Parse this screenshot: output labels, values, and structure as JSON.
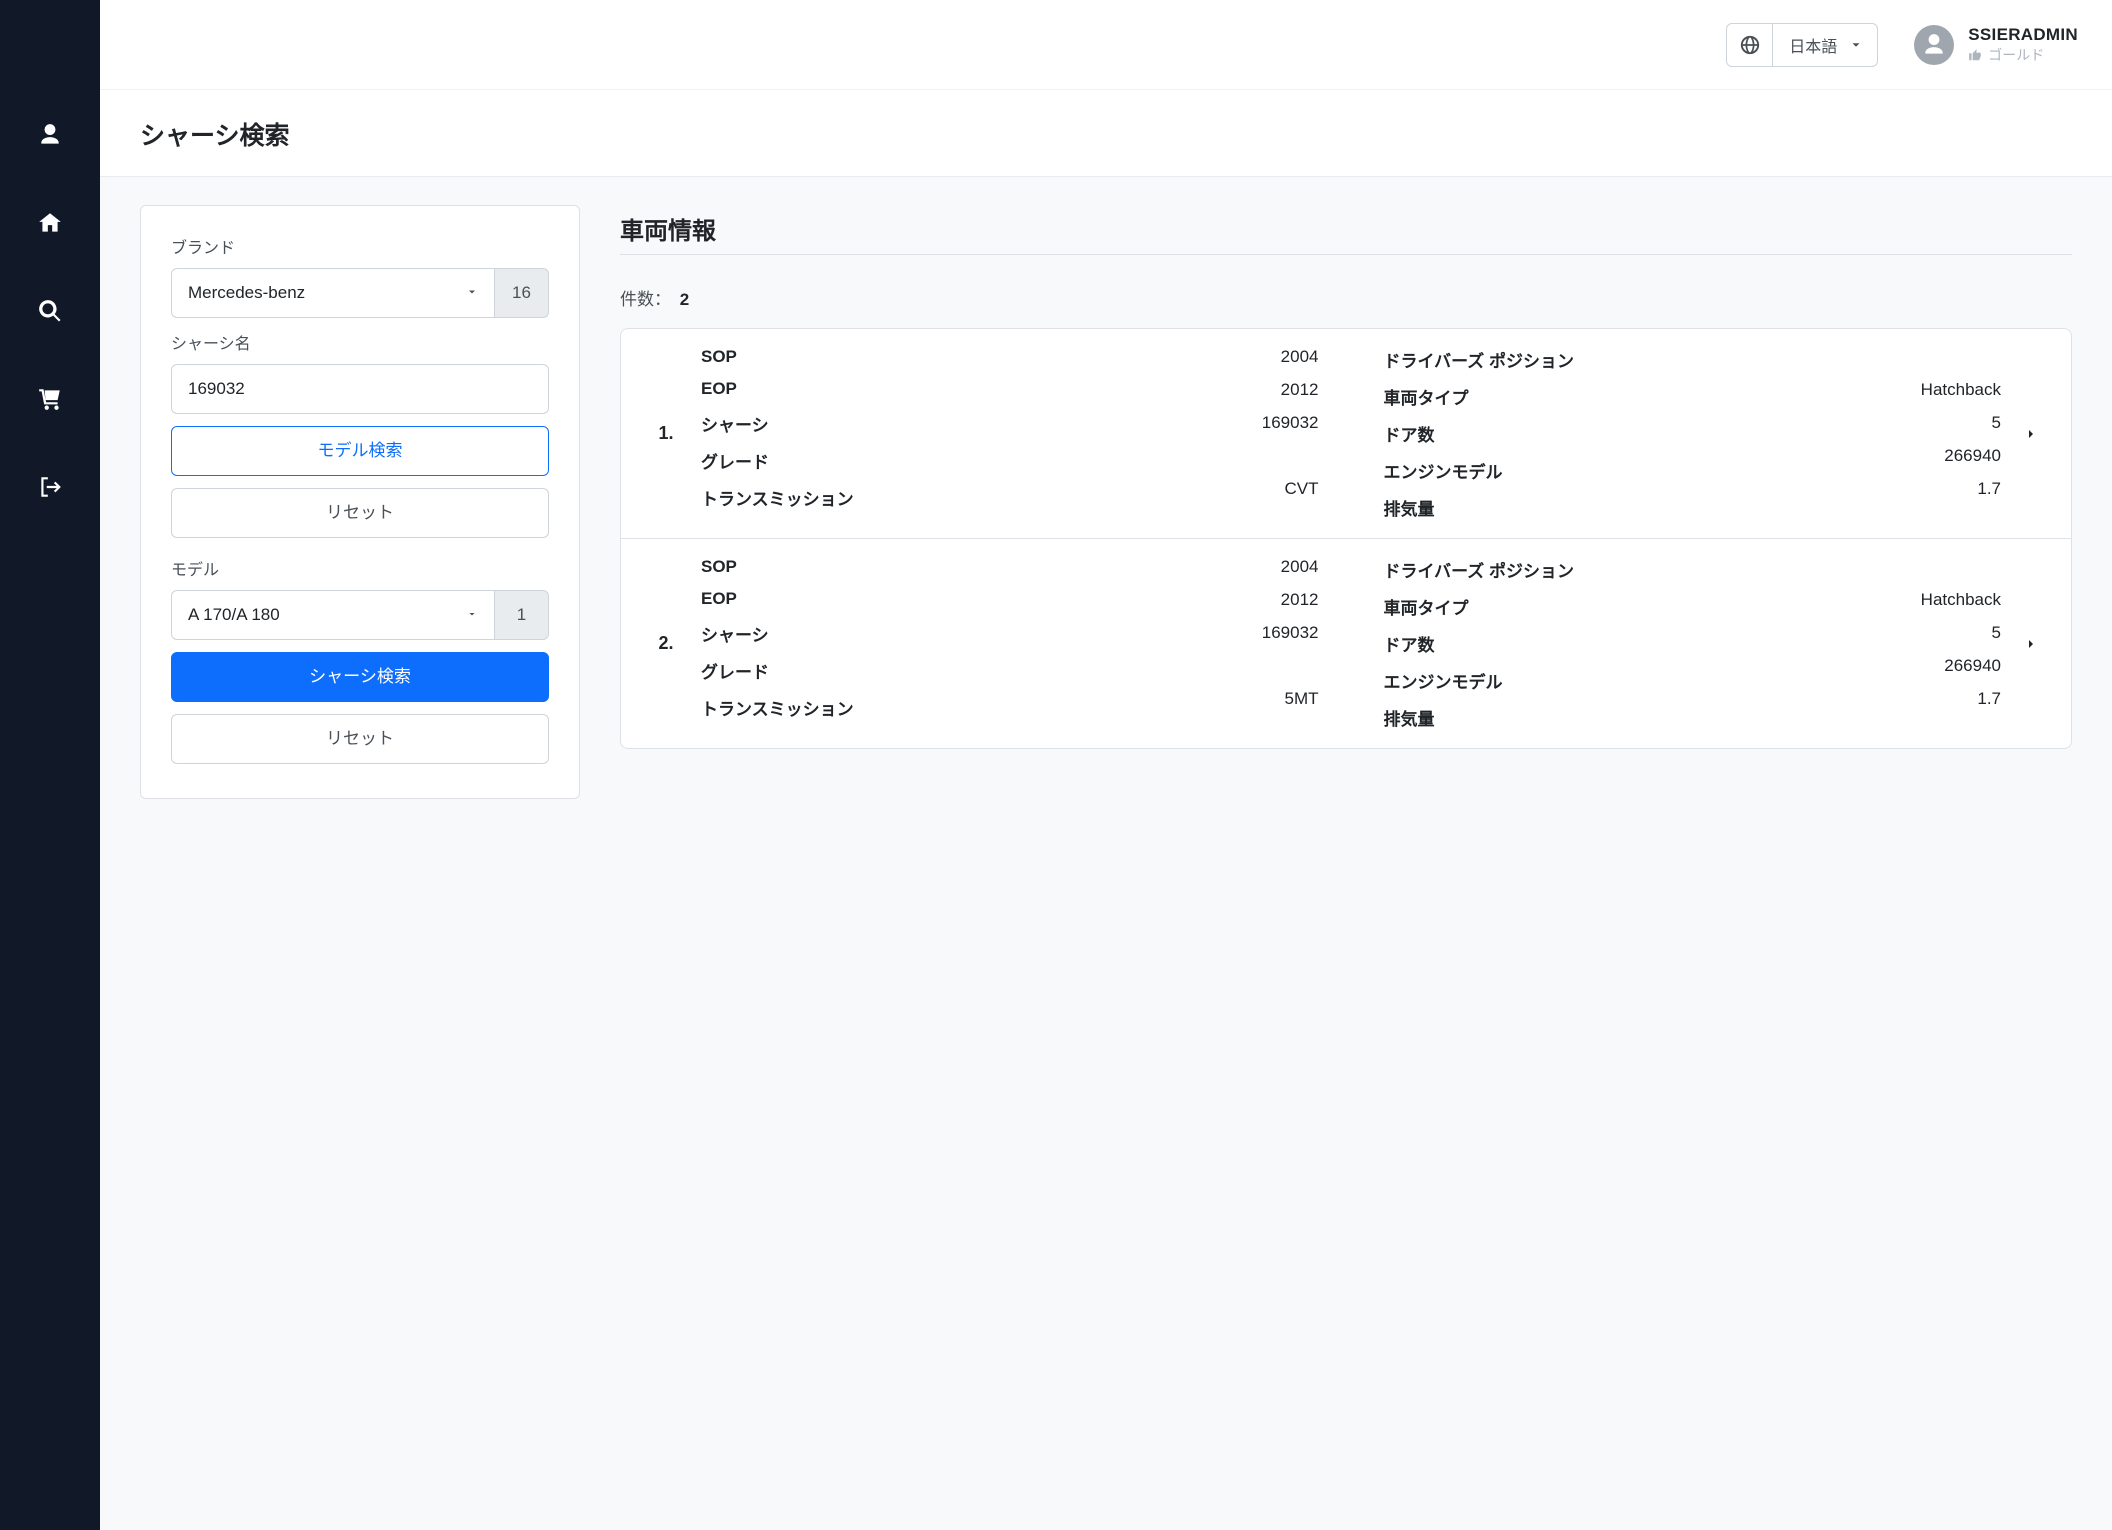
{
  "header": {
    "language_label": "日本語",
    "user_name": "SSIERADMIN",
    "user_rank": "ゴールド"
  },
  "page": {
    "title": "シャーシ検索"
  },
  "filter": {
    "brand_label": "ブランド",
    "brand_value": "Mercedes-benz",
    "brand_count": "16",
    "chassis_name_label": "シャーシ名",
    "chassis_name_value": "169032",
    "model_search_btn": "モデル検索",
    "reset_btn_1": "リセット",
    "model_label": "モデル",
    "model_value": "A 170/A 180",
    "model_count": "1",
    "chassis_search_btn": "シャーシ検索",
    "reset_btn_2": "リセット"
  },
  "results": {
    "title": "車両情報",
    "count_label": "件数：",
    "count_value": "2",
    "fields_left": {
      "sop": "SOP",
      "eop": "EOP",
      "chassis": "シャーシ",
      "grade": "グレード",
      "transmission": "トランスミッション"
    },
    "fields_right": {
      "driver_pos": "ドライバーズ ポジション",
      "vehicle_type": "車両タイプ",
      "doors": "ドア数",
      "engine_model": "エンジンモデル",
      "displacement": "排気量"
    },
    "items": [
      {
        "index": "1.",
        "sop": "2004",
        "eop": "2012",
        "chassis": "169032",
        "grade": "",
        "transmission": "CVT",
        "driver_pos": "",
        "vehicle_type": "Hatchback",
        "doors": "5",
        "engine_model": "266940",
        "displacement": "1.7"
      },
      {
        "index": "2.",
        "sop": "2004",
        "eop": "2012",
        "chassis": "169032",
        "grade": "",
        "transmission": "5MT",
        "driver_pos": "",
        "vehicle_type": "Hatchback",
        "doors": "5",
        "engine_model": "266940",
        "displacement": "1.7"
      }
    ]
  }
}
